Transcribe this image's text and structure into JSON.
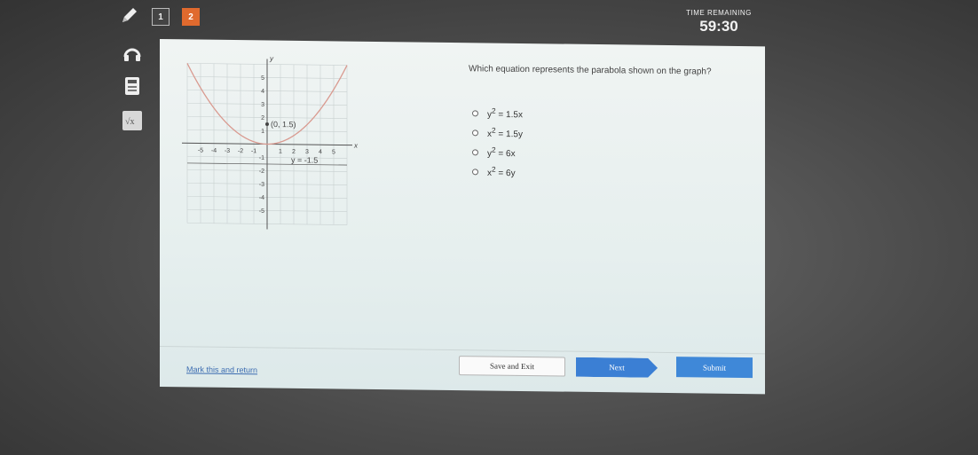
{
  "toolbar": {
    "tabs": [
      {
        "label": "1",
        "active": false
      },
      {
        "label": "2",
        "active": true
      }
    ]
  },
  "timer": {
    "label": "TIME REMAINING",
    "value": "59:30"
  },
  "question": {
    "prompt": "Which equation represents the parabola shown on the graph?",
    "options": [
      {
        "base": "y",
        "exp": "2",
        "rest": " = 1.5x"
      },
      {
        "base": "x",
        "exp": "2",
        "rest": " = 1.5y"
      },
      {
        "base": "y",
        "exp": "2",
        "rest": " = 6x"
      },
      {
        "base": "x",
        "exp": "2",
        "rest": " = 6y"
      }
    ]
  },
  "graph": {
    "axis_x_label": "x",
    "axis_y_label": "y",
    "x_ticks": [
      "-5",
      "-4",
      "-3",
      "-2",
      "-1",
      "1",
      "2",
      "3",
      "4",
      "5"
    ],
    "y_ticks": [
      "5",
      "4",
      "3",
      "2",
      "1",
      "-1",
      "-2",
      "-3",
      "-4",
      "-5"
    ],
    "focus_label": "(0, 1.5)",
    "directrix_label": "y = -1.5",
    "focus": [
      0,
      1.5
    ],
    "directrix_y": -1.5,
    "x_range": [
      -6,
      6
    ],
    "y_range": [
      -6,
      6
    ],
    "curve_color": "#d99a90"
  },
  "footer": {
    "mark_link": "Mark this and return",
    "save_exit": "Save and Exit",
    "next": "Next",
    "submit": "Submit"
  },
  "colors": {
    "active_tab": "#e06a2e",
    "primary_button": "#3b7fd4"
  }
}
